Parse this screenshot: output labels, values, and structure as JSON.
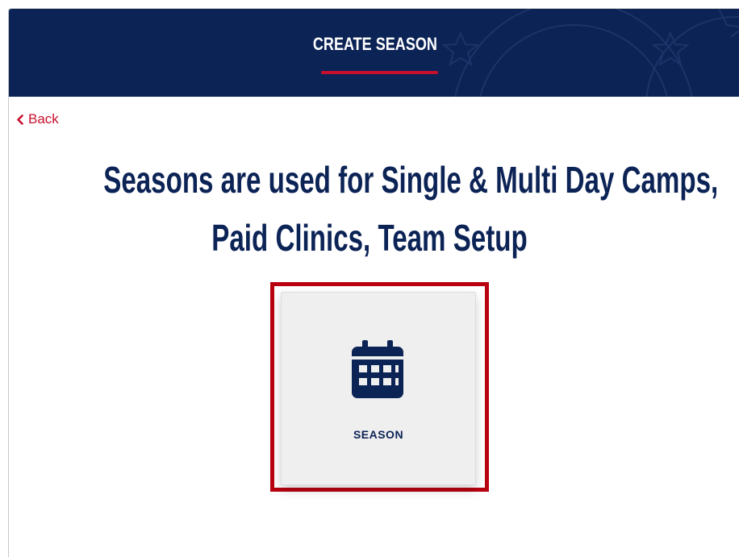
{
  "header": {
    "title": "CREATE SEASON",
    "accent_color": "#c8102e",
    "background_color": "#0c2356"
  },
  "nav": {
    "back_label": "Back",
    "back_icon": "chevron-left-icon"
  },
  "main": {
    "headline_line1": "Seasons are used for Single & Multi Day Camps,",
    "headline_line2": "Paid Clinics, Team Setup",
    "options": [
      {
        "label": "SEASON",
        "icon": "calendar-icon",
        "highlighted": true
      }
    ]
  }
}
